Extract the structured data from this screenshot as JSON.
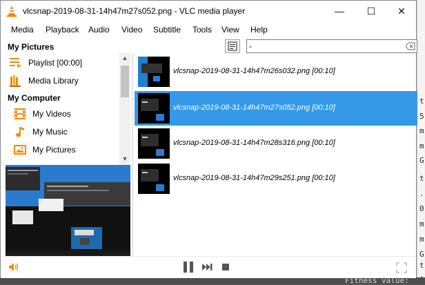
{
  "window": {
    "title": "vlcsnap-2019-08-31-14h47m27s052.png - VLC media player",
    "minimize_glyph": "—",
    "maximize_glyph": "☐",
    "close_glyph": "✕"
  },
  "menu": [
    "Media",
    "Playback",
    "Audio",
    "Video",
    "Subtitle",
    "Tools",
    "View",
    "Help"
  ],
  "sidebar": {
    "sections": [
      {
        "title": "My Pictures",
        "items": [
          {
            "label": "Playlist [00:00]",
            "icon": "playlist-icon"
          },
          {
            "label": "Media Library",
            "icon": "media-library-icon"
          }
        ]
      },
      {
        "title": "My Computer",
        "items": [
          {
            "label": "My Videos",
            "icon": "film-icon"
          },
          {
            "label": "My Music",
            "icon": "music-note-icon"
          },
          {
            "label": "My Pictures",
            "icon": "picture-icon"
          }
        ]
      }
    ]
  },
  "search": {
    "value": "-",
    "placeholder": ""
  },
  "playlist": {
    "items": [
      {
        "label": "vlcsnap-2019-08-31-14h47m26s032.png [00:10]",
        "selected": false
      },
      {
        "label": "vlcsnap-2019-08-31-14h47m27s052.png [00:10]",
        "selected": true
      },
      {
        "label": "vlcsnap-2019-08-31-14h47m28s316.png [00:10]",
        "selected": false
      },
      {
        "label": "vlcsnap-2019-08-31-14h47m29s251.png [00:10]",
        "selected": false
      }
    ]
  },
  "background": {
    "right_chars": [
      "t",
      "5",
      "m",
      "m",
      "G",
      "t",
      ".",
      "0",
      "m",
      "m",
      "G",
      "t",
      "."
    ],
    "left_char": "[",
    "bottom_text": "Fitness value:"
  },
  "colors": {
    "selection": "#3399e8",
    "vlc_orange": "#f08a00",
    "accent_blue": "#1c7fd6"
  }
}
